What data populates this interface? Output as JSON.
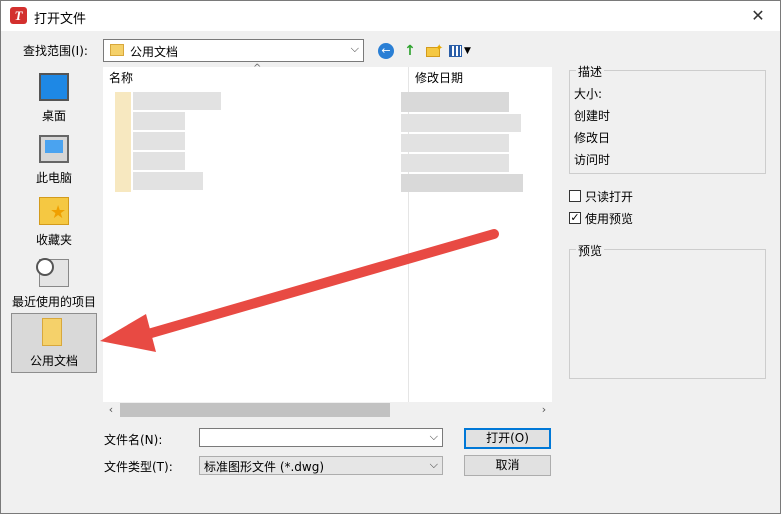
{
  "window": {
    "title": "打开文件",
    "app_icon_glyph": "T",
    "close_glyph": "✕"
  },
  "toolbar": {
    "look_in_label": "查找范围(I):",
    "look_in_value": "公用文档",
    "back_glyph": "←",
    "up_glyph": "↑",
    "new_folder_glyph": "✦",
    "views_dropdown_glyph": "▼"
  },
  "places": [
    {
      "label": "桌面",
      "icon": "desktop-icon"
    },
    {
      "label": "此电脑",
      "icon": "computer-icon"
    },
    {
      "label": "收藏夹",
      "icon": "favorites-icon"
    },
    {
      "label": "最近使用的项目",
      "icon": "recent-items-icon"
    },
    {
      "label": "公用文档",
      "icon": "public-documents-icon",
      "selected": true
    }
  ],
  "file_list": {
    "columns": [
      "名称",
      "修改日期"
    ],
    "sort_glyph": "^"
  },
  "form": {
    "file_name_label": "文件名(N):",
    "file_name_value": "",
    "file_type_label": "文件类型(T):",
    "file_type_value": "标准图形文件 (*.dwg)",
    "open_button": "打开(O)",
    "cancel_button": "取消"
  },
  "details": {
    "title": "描述",
    "size_label": "大小:",
    "created_label": "创建时",
    "modified_label": "修改日",
    "accessed_label": "访问时"
  },
  "options": {
    "read_only_label": "只读打开",
    "read_only_checked": false,
    "use_preview_label": "使用预览",
    "use_preview_checked": true
  },
  "preview": {
    "title": "预览"
  },
  "colors": {
    "annotation_arrow": "#e84a43",
    "accent": "#0078d7"
  }
}
